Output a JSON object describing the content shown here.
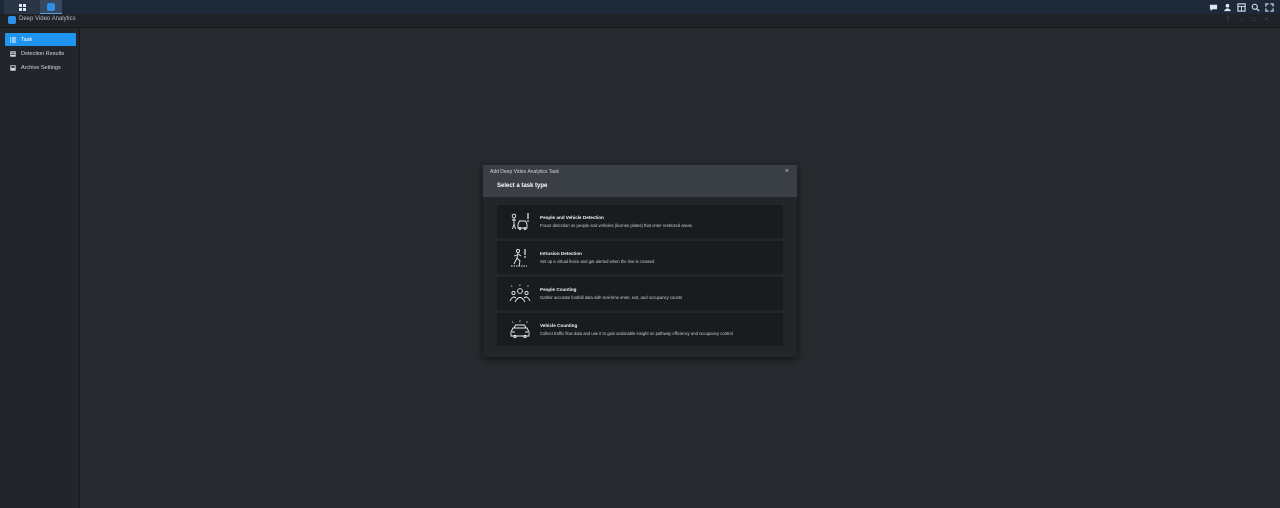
{
  "taskbar": {
    "grid_icon": "grid-icon",
    "app_icon": "deep-video-analytics-icon",
    "tray_icons": [
      "chat-icon",
      "user-icon",
      "widgets-icon",
      "search-icon",
      "fullscreen-icon"
    ]
  },
  "window": {
    "title": "Deep Video Analytics",
    "controls": [
      "help-icon",
      "minimize-icon",
      "maximize-icon",
      "close-icon"
    ]
  },
  "sidebar": {
    "items": [
      {
        "label": "Task",
        "icon": "list-icon",
        "active": true
      },
      {
        "label": "Detection Results",
        "icon": "results-icon",
        "active": false
      },
      {
        "label": "Archive Settings",
        "icon": "archive-icon",
        "active": false
      }
    ]
  },
  "dialog": {
    "title": "Add Deep Video Analytics Task",
    "subtitle": "Select a task type",
    "close_label": "×",
    "tasks": [
      {
        "title": "People and Vehicle Detection",
        "description": "Focus detection on people and vehicles (license plates) that enter restricted areas.",
        "icon": "person-vehicle-alert-icon"
      },
      {
        "title": "Intrusion Detection",
        "description": "Set up a virtual fence and get alerted when the line is crossed",
        "icon": "intruder-alert-icon"
      },
      {
        "title": "People Counting",
        "description": "Gather accurate footfall data with real-time enter, exit, and occupancy counts",
        "icon": "people-count-icon"
      },
      {
        "title": "Vehicle Counting",
        "description": "Collect traffic flow data and use it to gain actionable insight on pathway efficiency and occupancy control",
        "icon": "vehicle-count-icon"
      }
    ]
  },
  "colors": {
    "accent": "#1f95f0",
    "background": "#272a2f",
    "sidebar": "#22252a",
    "dialog_header": "#3a3e45",
    "card": "#191b1e"
  }
}
